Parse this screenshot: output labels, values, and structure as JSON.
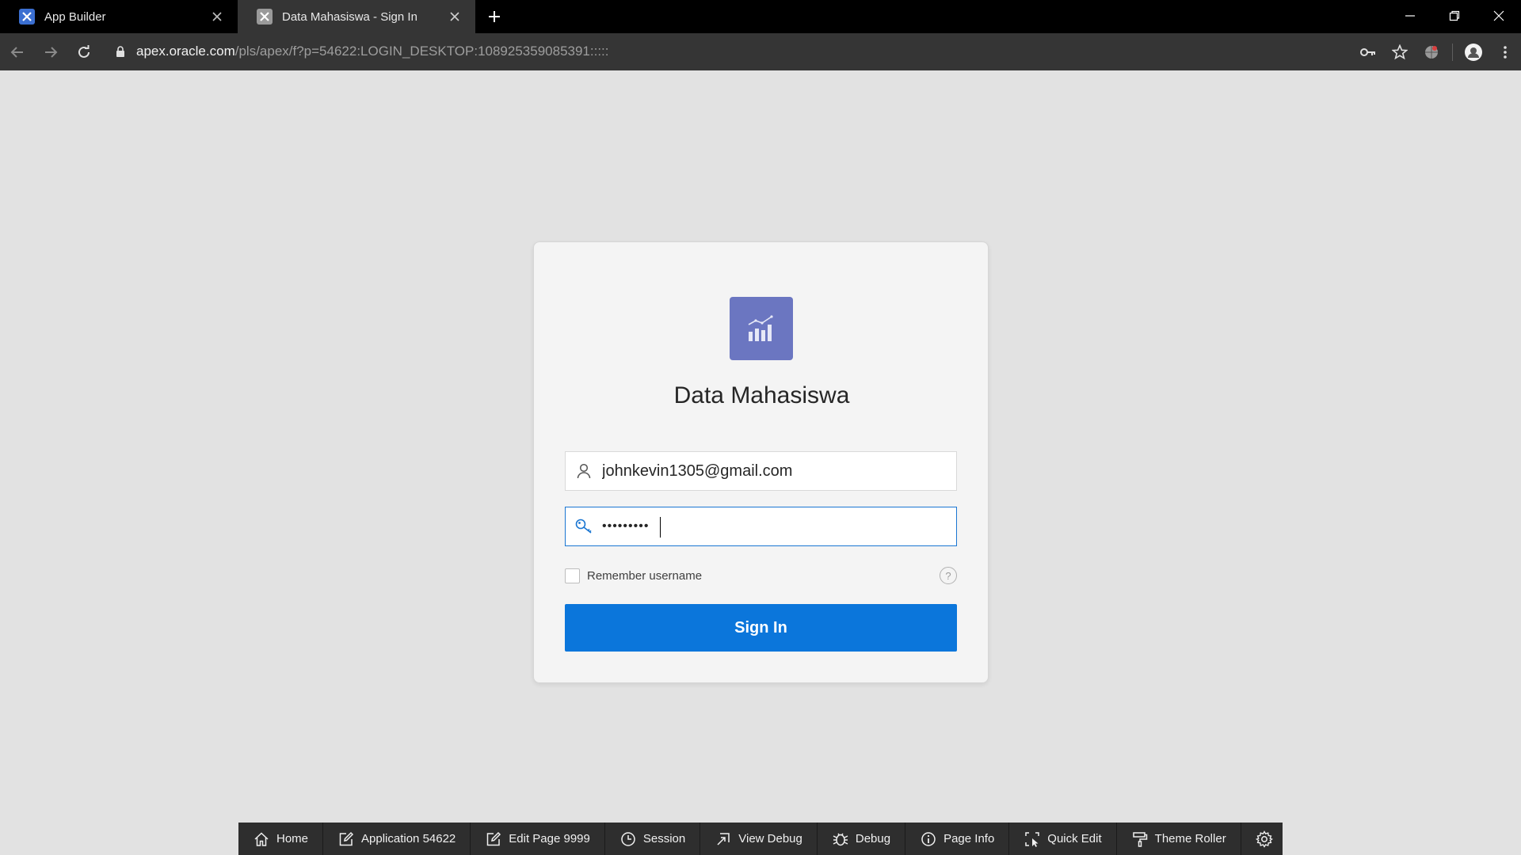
{
  "browser": {
    "tabs": [
      {
        "title": "App Builder",
        "active": false,
        "favicon": "apex-builder-icon"
      },
      {
        "title": "Data Mahasiswa - Sign In",
        "active": true,
        "favicon": "apex-app-icon"
      }
    ],
    "url_host": "apex.oracle.com",
    "url_path": "/pls/apex/f?p=54622:LOGIN_DESKTOP:108925359085391:::::"
  },
  "login": {
    "app_title": "Data Mahasiswa",
    "username_value": "johnkevin1305@gmail.com",
    "password_value": "•••••••••",
    "remember_label": "Remember username",
    "remember_checked": false,
    "help_symbol": "?",
    "signin_label": "Sign In",
    "accent_color": "#0b76db",
    "logo_color": "#6b76c1"
  },
  "devbar": {
    "items": [
      {
        "label": "Home",
        "icon": "home-icon"
      },
      {
        "label": "Application 54622",
        "icon": "edit-icon"
      },
      {
        "label": "Edit Page 9999",
        "icon": "edit-icon"
      },
      {
        "label": "Session",
        "icon": "clock-icon"
      },
      {
        "label": "View Debug",
        "icon": "view-debug-icon"
      },
      {
        "label": "Debug",
        "icon": "bug-icon"
      },
      {
        "label": "Page Info",
        "icon": "info-icon"
      },
      {
        "label": "Quick Edit",
        "icon": "quick-edit-icon"
      },
      {
        "label": "Theme Roller",
        "icon": "paint-roller-icon"
      }
    ],
    "settings_icon": "gear-icon"
  }
}
